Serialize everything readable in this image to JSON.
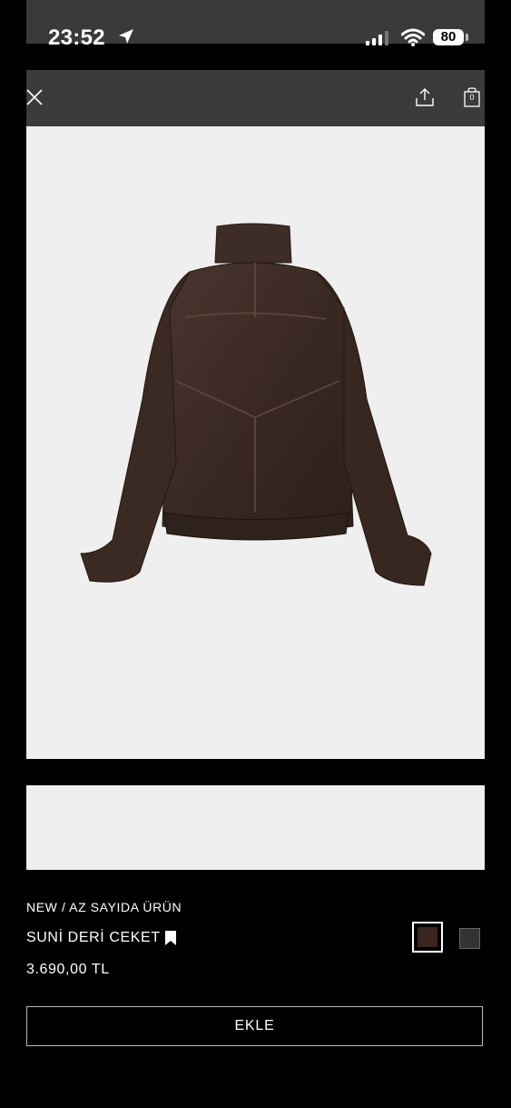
{
  "status_bar": {
    "time": "23:52",
    "battery": "80"
  },
  "header": {
    "bag_count": "0"
  },
  "product": {
    "tag": "NEW / AZ SAYIDA ÜRÜN",
    "name": "SUNİ DERİ CEKET",
    "price": "3.690,00 TL",
    "colors": [
      "#3b2520",
      "#333333"
    ]
  },
  "actions": {
    "add_label": "EKLE"
  },
  "icons": [
    "location-arrow-icon",
    "cellular-signal-icon",
    "wifi-icon",
    "close-icon",
    "share-icon",
    "shopping-bag-icon",
    "bookmark-icon"
  ]
}
